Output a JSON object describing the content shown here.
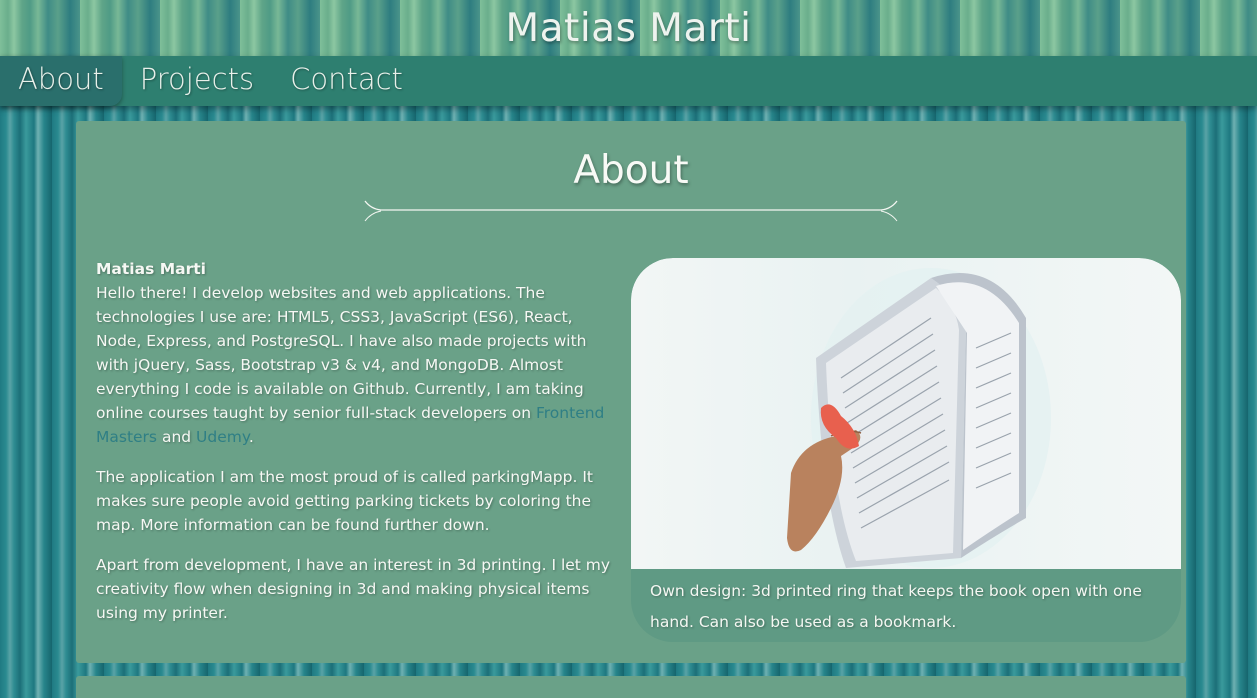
{
  "header": {
    "title": "Matias Marti"
  },
  "nav": {
    "items": [
      {
        "label": "About"
      },
      {
        "label": "Projects"
      },
      {
        "label": "Contact"
      }
    ]
  },
  "about": {
    "title": "About",
    "name": "Matias Marti",
    "intro_text": "Hello there! I develop websites and web applications. The technologies I use are: HTML5, CSS3, JavaScript (ES6), React, Node, Express, and PostgreSQL. I have also made projects with with jQuery, Sass, Bootstrap v3 & v4, and MongoDB. Almost everything I code is available on Github. Currently, I am taking online courses taught by senior full-stack developers on ",
    "link_frontend_masters": "Frontend Masters",
    "and_text": " and ",
    "link_udemy": "Udemy",
    "period": ".",
    "paragraph2": "The application I am the most proud of is called parkingMapp. It makes sure people avoid getting parking tickets by coloring the map. More information can be found further down.",
    "paragraph3": "Apart from development, I have an interest in 3d printing. I let my creativity flow when designing in 3d and making physical items using my printer.",
    "image_caption": "Own design: 3d printed ring that keeps the book open with one hand. Can also be used as a bookmark."
  },
  "colors": {
    "nav_bg": "#2e7f70",
    "panel_bg": "#6aa188",
    "link": "#2f7f85",
    "ring": "#e8604e"
  }
}
